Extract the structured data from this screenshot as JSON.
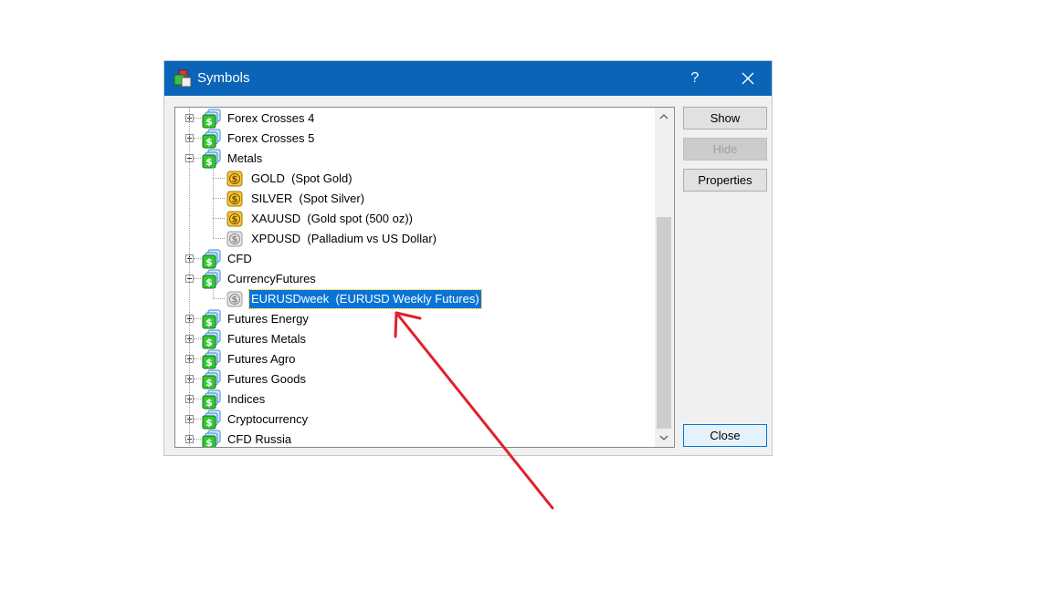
{
  "window": {
    "title": "Symbols",
    "help_label": "?",
    "title_icon": "symbols-app-icon",
    "close_icon": "close-icon"
  },
  "tree": {
    "rows": [
      {
        "label": "Forex Crosses 4",
        "kind": "folder",
        "expander": "plus"
      },
      {
        "label": "Forex Crosses 5",
        "kind": "folder",
        "expander": "plus"
      },
      {
        "label": "Metals",
        "kind": "folder",
        "expander": "minus"
      },
      {
        "label": "GOLD  (Spot Gold)",
        "kind": "symbol",
        "icon": "gold-dollar-icon"
      },
      {
        "label": "SILVER  (Spot Silver)",
        "kind": "symbol",
        "icon": "gold-dollar-icon"
      },
      {
        "label": "XAUUSD  (Gold spot (500 oz))",
        "kind": "symbol",
        "icon": "gold-dollar-icon"
      },
      {
        "label": "XPDUSD  (Palladium vs US Dollar)",
        "kind": "symbol",
        "icon": "gray-dollar-icon"
      },
      {
        "label": "CFD",
        "kind": "folder",
        "expander": "plus"
      },
      {
        "label": "CurrencyFutures",
        "kind": "folder",
        "expander": "minus"
      },
      {
        "label": "EURUSDweek  (EURUSD Weekly Futures)",
        "kind": "symbol",
        "icon": "gray-dollar-icon",
        "selected": true
      },
      {
        "label": "Futures Energy",
        "kind": "folder",
        "expander": "plus"
      },
      {
        "label": "Futures Metals",
        "kind": "folder",
        "expander": "plus"
      },
      {
        "label": "Futures Agro",
        "kind": "folder",
        "expander": "plus"
      },
      {
        "label": "Futures Goods",
        "kind": "folder",
        "expander": "plus"
      },
      {
        "label": "Indices",
        "kind": "folder",
        "expander": "plus"
      },
      {
        "label": "Cryptocurrency",
        "kind": "folder",
        "expander": "plus"
      },
      {
        "label": "CFD Russia",
        "kind": "folder",
        "expander": "plus"
      }
    ],
    "scroll_position": 0.55,
    "scroll_visible_fraction": 0.7
  },
  "buttons": {
    "show": "Show",
    "hide": "Hide",
    "properties": "Properties",
    "close": "Close"
  },
  "colors": {
    "titlebar": "#0a64b8",
    "selection": "#0a74d6",
    "annotation_arrow": "#e0202a"
  }
}
